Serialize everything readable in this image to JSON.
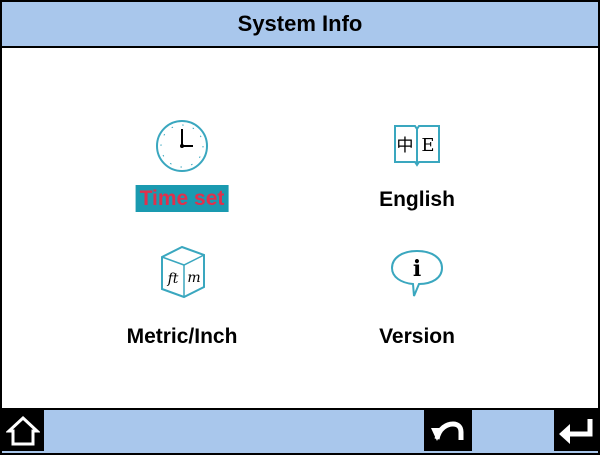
{
  "header": {
    "title": "System Info"
  },
  "menu": {
    "items": [
      {
        "label": "Time set",
        "icon": "clock-icon",
        "selected": true
      },
      {
        "label": "English",
        "icon": "book-language-icon",
        "selected": false
      },
      {
        "label": "Metric/Inch",
        "icon": "unit-cube-icon",
        "selected": false
      },
      {
        "label": "Version",
        "icon": "info-bubble-icon",
        "selected": false
      }
    ]
  },
  "icon_glyphs": {
    "book_left": "中",
    "book_right": "E",
    "cube_left": "ft",
    "cube_right": "m",
    "info": "i"
  },
  "footer": {
    "buttons": [
      {
        "icon": "home-icon"
      },
      {
        "icon": "back-icon"
      },
      {
        "icon": "enter-icon"
      }
    ]
  },
  "colors": {
    "bar_background": "#a9c7ec",
    "selection_background": "#1a9ab0",
    "selection_text": "#e0304c",
    "icon_stroke": "#3aa7bf"
  }
}
